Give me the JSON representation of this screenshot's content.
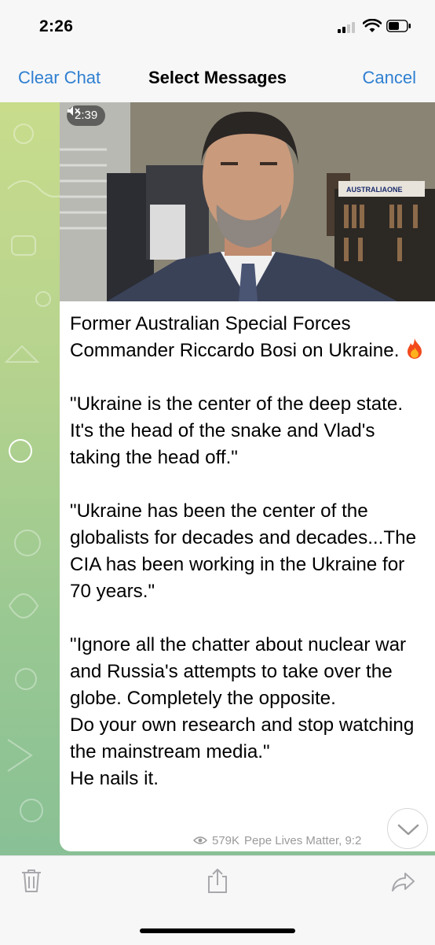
{
  "status_bar": {
    "time": "2:26"
  },
  "nav": {
    "clear_label": "Clear Chat",
    "title": "Select Messages",
    "cancel_label": "Cancel"
  },
  "message": {
    "video": {
      "duration": "2:39",
      "watermark": "AUSTRALIAONE"
    },
    "caption": {
      "line_1": "Former Australian Special Forces Commander Riccardo Bosi on Ukraine.",
      "quote_1": "\"Ukraine is the center of the deep state. It's the head of the snake and Vlad's taking the head off.\"",
      "quote_2": "\"Ukraine has been the center of the globalists for decades and decades...The CIA has been working in the Ukraine for 70 years.\"",
      "quote_3": "\"Ignore all the chatter about nuclear war and Russia's attempts to take over the globe. Completely the opposite.\nDo your own research and stop watching the mainstream media.\"\nHe nails it."
    },
    "views": "579K",
    "author": "Pepe Lives Matter, 9:2",
    "accent_color": "#2f7fd1"
  },
  "toolbar": {
    "icons": [
      "trash-icon",
      "share-icon",
      "forward-icon"
    ]
  }
}
